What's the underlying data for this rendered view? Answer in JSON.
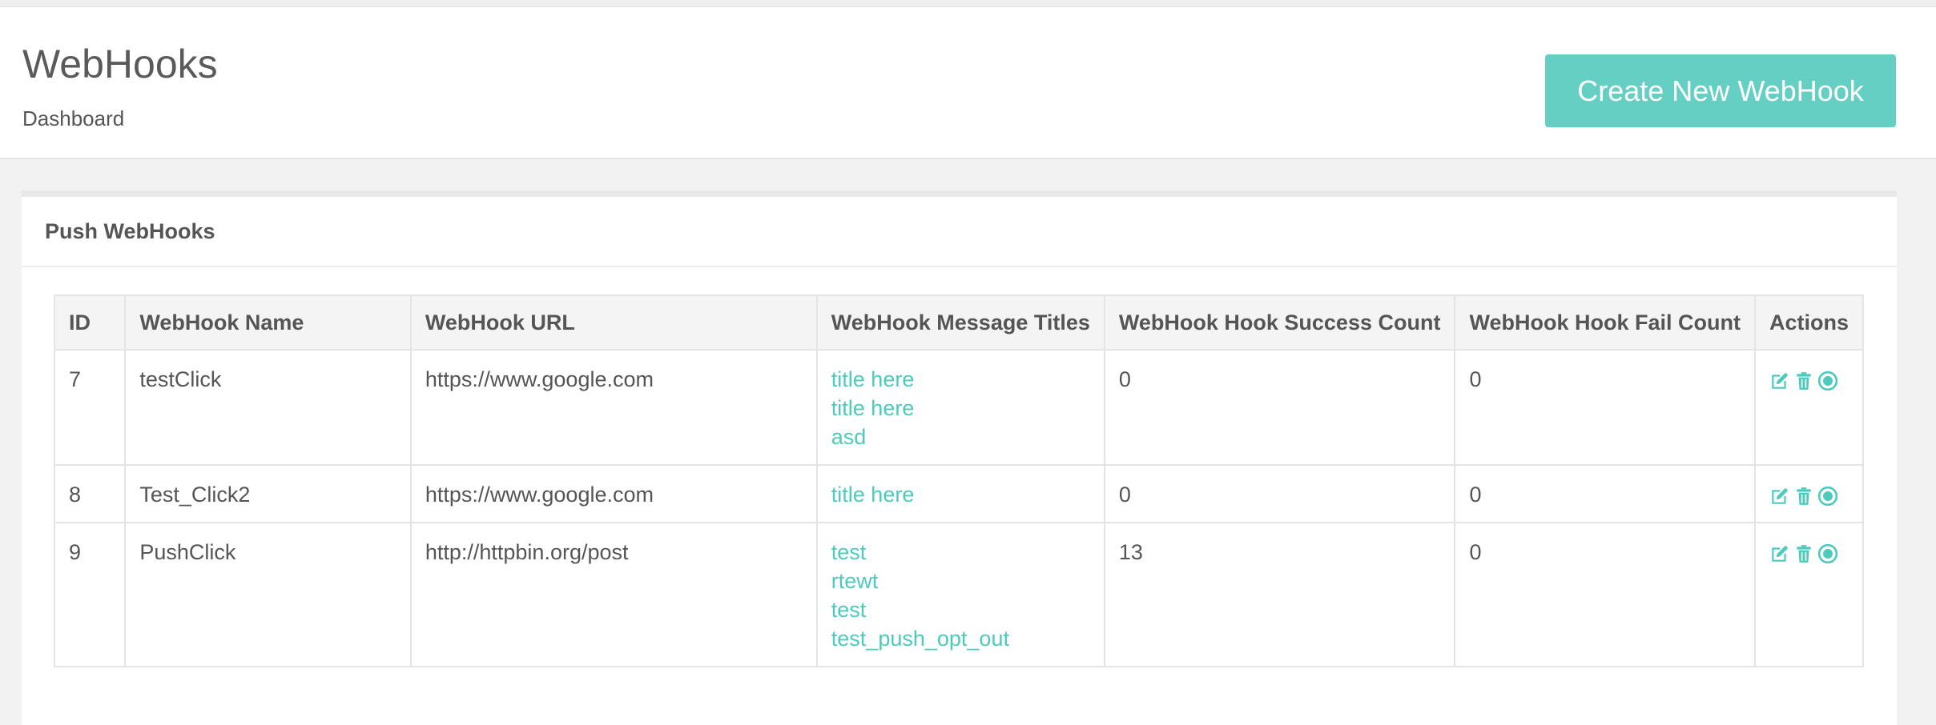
{
  "page": {
    "title": "WebHooks",
    "breadcrumb": "Dashboard",
    "create_button": "Create New WebHook"
  },
  "panel": {
    "title": "Push WebHooks"
  },
  "table": {
    "columns": [
      "ID",
      "WebHook Name",
      "WebHook URL",
      "WebHook Message Titles",
      "WebHook Hook Success Count",
      "WebHook Hook Fail Count",
      "Actions"
    ],
    "rows": [
      {
        "id": "7",
        "name": "testClick",
        "url": "https://www.google.com",
        "titles": [
          "title here",
          "title here",
          "asd"
        ],
        "success": "0",
        "fail": "0"
      },
      {
        "id": "8",
        "name": "Test_Click2",
        "url": "https://www.google.com",
        "titles": [
          "title here"
        ],
        "success": "0",
        "fail": "0"
      },
      {
        "id": "9",
        "name": "PushClick",
        "url": "http://httpbin.org/post",
        "titles": [
          "test",
          "rtewt",
          "test",
          "test_push_opt_out"
        ],
        "success": "13",
        "fail": "0"
      }
    ],
    "action_icons": [
      "edit-icon",
      "trash-icon",
      "stop-circle-icon"
    ]
  },
  "colors": {
    "accent": "#66cfc4",
    "link": "#4ccbbd",
    "text": "#555555"
  }
}
